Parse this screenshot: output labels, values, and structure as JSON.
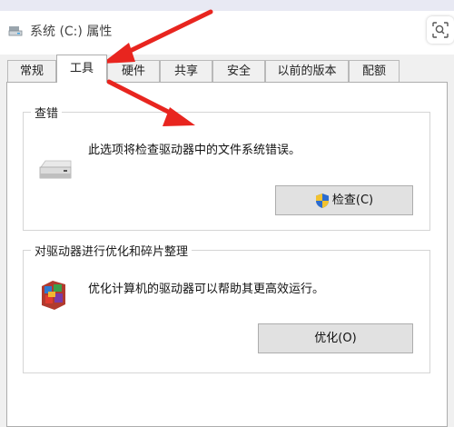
{
  "window": {
    "title": "系统 (C:) 属性"
  },
  "tabs": [
    {
      "label": "常规"
    },
    {
      "label": "工具"
    },
    {
      "label": "硬件"
    },
    {
      "label": "共享"
    },
    {
      "label": "安全"
    },
    {
      "label": "以前的版本"
    },
    {
      "label": "配额"
    }
  ],
  "active_tab": "工具",
  "error_check": {
    "title": "查错",
    "description": "此选项将检查驱动器中的文件系统错误。",
    "button_label": "检查(C)"
  },
  "optimize": {
    "title": "对驱动器进行优化和碎片整理",
    "description": "优化计算机的驱动器可以帮助其更高效运行。",
    "button_label": "优化(O)"
  },
  "colors": {
    "annotation_arrow": "#e8251f",
    "shield_blue": "#2b6cd0",
    "shield_yellow": "#f2c230"
  }
}
